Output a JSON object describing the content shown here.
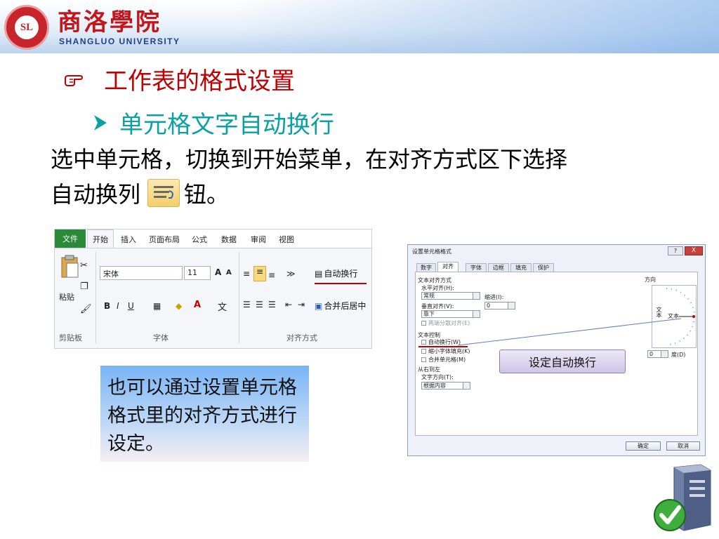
{
  "header": {
    "logo_text": "SL",
    "university_cn": "商洛學院",
    "university_en": "SHANGLUO UNIVERSITY"
  },
  "slide": {
    "heading": "工作表的格式设置",
    "subheading": "单元格文字自动换行",
    "body_line1": "选中单元格，切换到开始菜单，在对齐方式区下选择",
    "body_line2_a": "自动换列",
    "body_line2_b": "钮。",
    "note": "也可以通过设置单元格格式里的对齐方式进行设定。",
    "callout": "设定自动换行"
  },
  "ribbon": {
    "tabs": [
      "文件",
      "开始",
      "插入",
      "页面布局",
      "公式",
      "数据",
      "审阅",
      "视图"
    ],
    "paste_label": "粘贴",
    "font_name": "宋体",
    "font_size": "11",
    "groups": [
      "剪贴板",
      "字体",
      "对齐方式"
    ],
    "wrap_text": "自动换行",
    "merge_center": "合并后居中"
  },
  "dialog": {
    "title": "设置单元格格式",
    "help": "?",
    "close": "X",
    "tabs": [
      "数字",
      "对齐",
      "字体",
      "边框",
      "填充",
      "保护"
    ],
    "section_align": "文本对齐方式",
    "h_align_label": "水平对齐(H):",
    "h_align_value": "常规",
    "indent_label": "缩进(I):",
    "indent_value": "0",
    "v_align_label": "垂直对齐(V):",
    "v_align_value": "靠下",
    "distributed": "两端分散对齐(E)",
    "section_control": "文本控制",
    "wrap": "自动换行(W)",
    "shrink": "缩小字体填充(K)",
    "merge": "合并单元格(M)",
    "section_rtl": "从右到左",
    "direction_label": "文字方向(T):",
    "direction_value": "根据内容",
    "orientation_label": "方向",
    "orientation_vertical": "文本",
    "orientation_text": "文本",
    "degree_value": "0",
    "degree_label": "度(D)",
    "ok": "确定",
    "cancel": "取消"
  },
  "colors": {
    "heading": "#c00000",
    "subheading": "#0aa1a3",
    "file_tab": "#2a8a3a"
  }
}
